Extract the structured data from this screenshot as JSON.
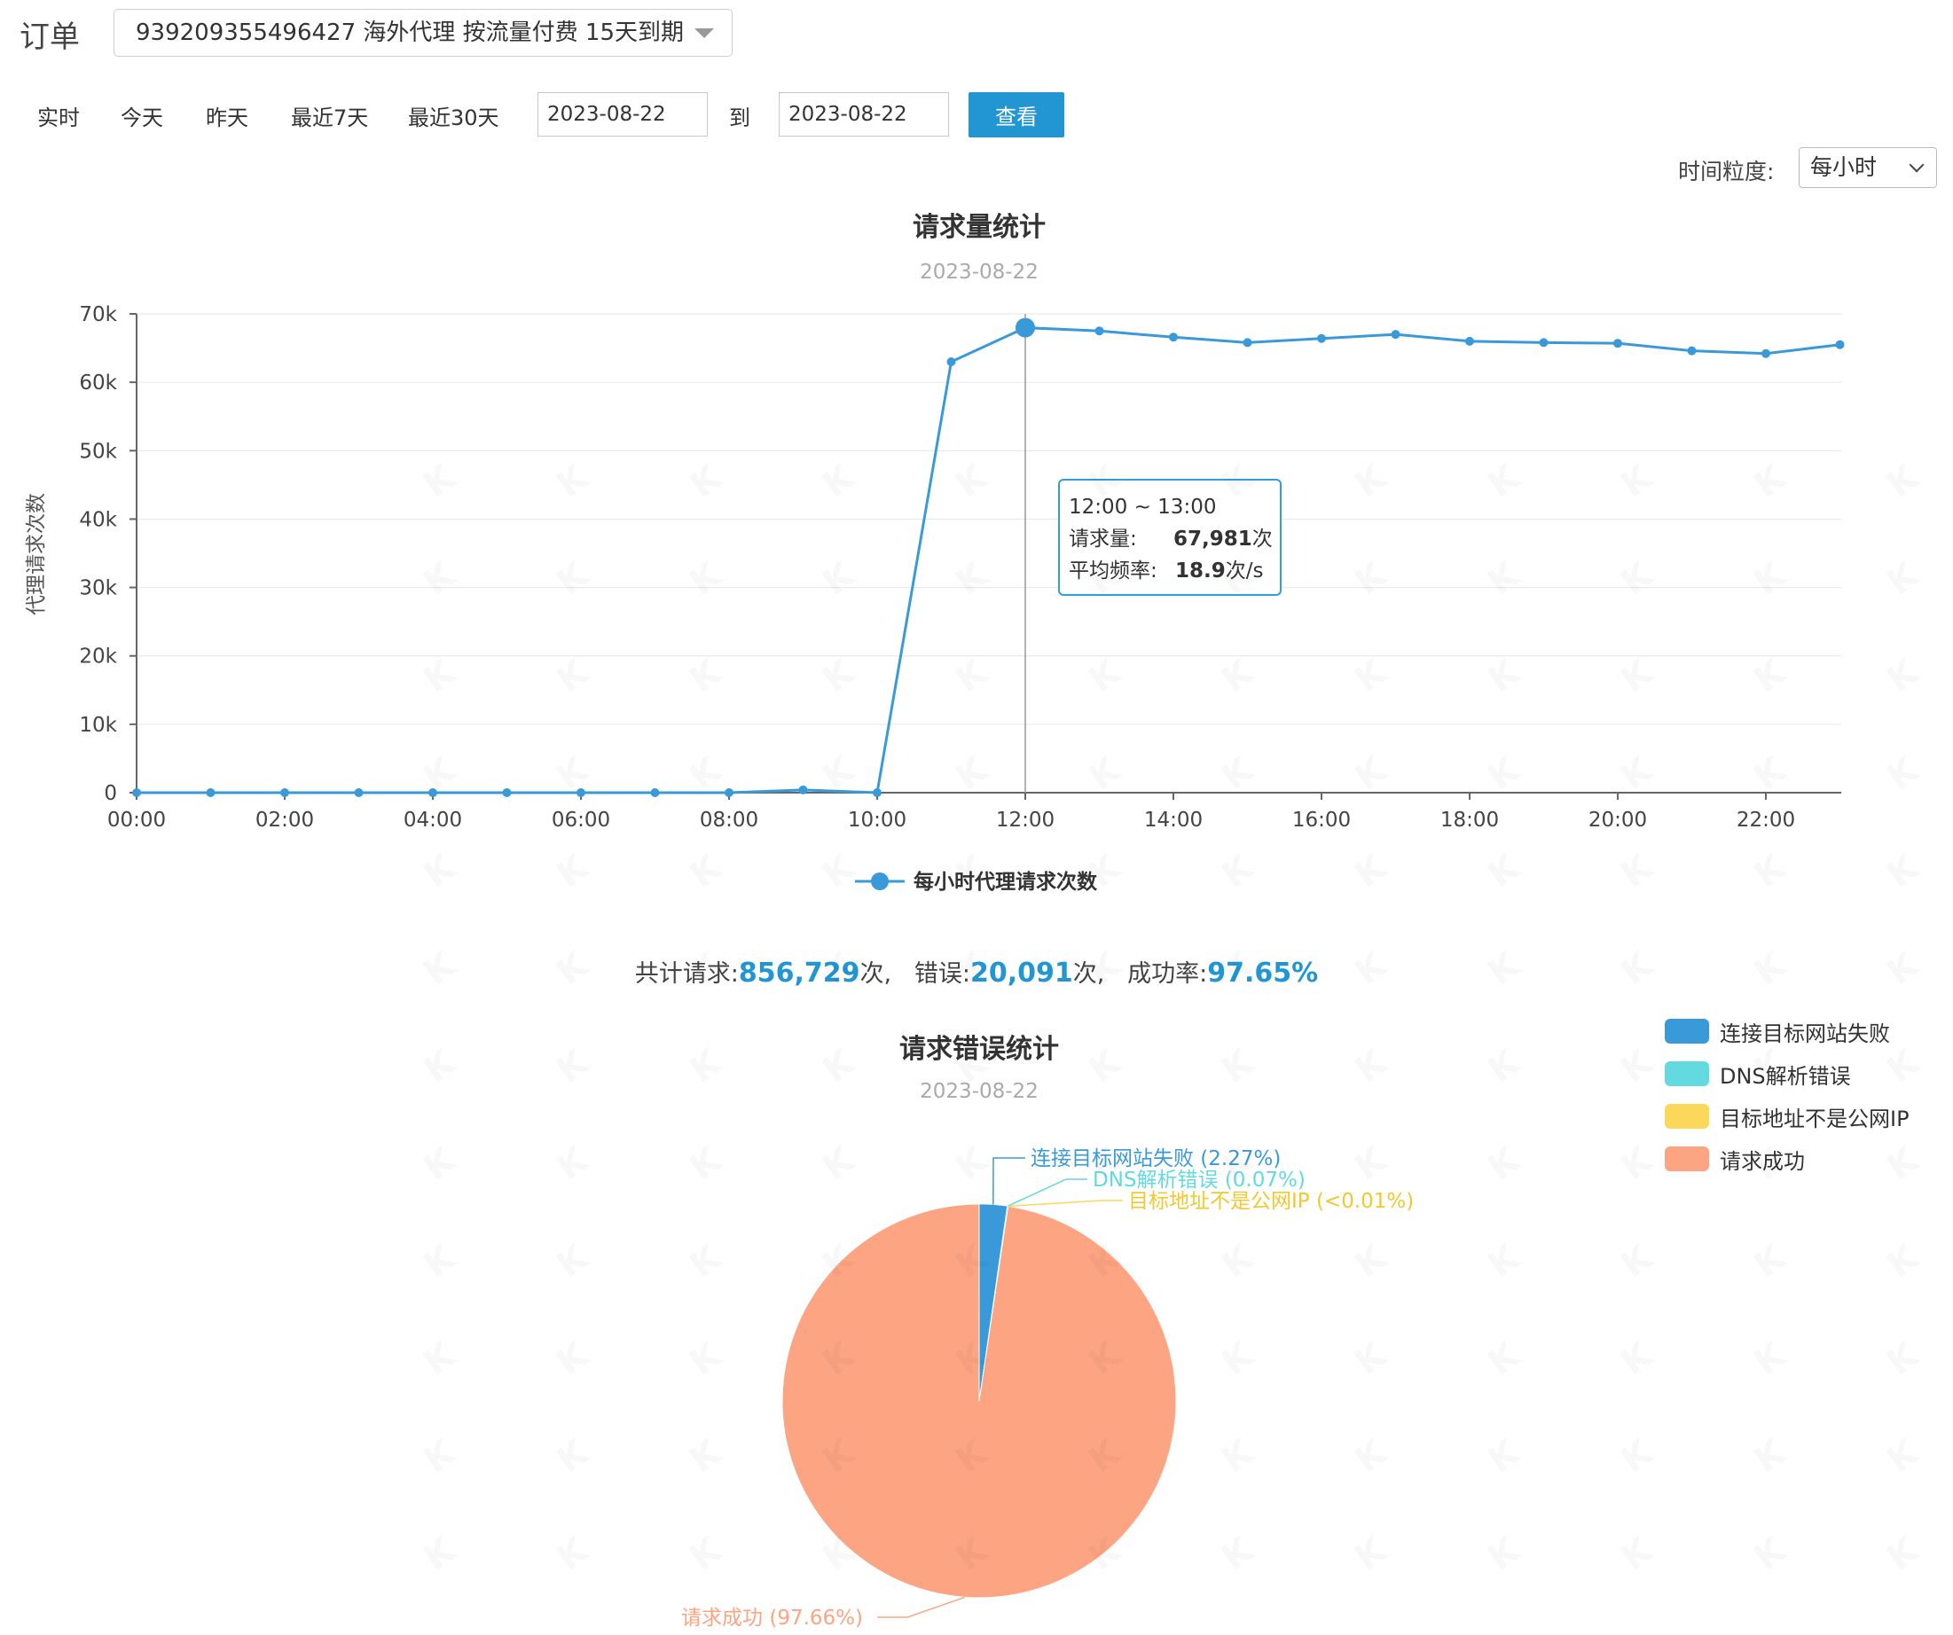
{
  "header": {
    "order_label": "订单",
    "order_select_value": "939209355496427  海外代理  按流量付费  15天到期"
  },
  "range": {
    "links": [
      "实时",
      "今天",
      "昨天",
      "最近7天",
      "最近30天"
    ],
    "start_date": "2023-08-22",
    "to_label": "到",
    "end_date": "2023-08-22",
    "view_button": "查看"
  },
  "granularity": {
    "label": "时间粒度:",
    "value": "每小时"
  },
  "colors": {
    "primary": "#2196d3",
    "line": "#3a9ad9",
    "error_connect": "#3a9ad9",
    "error_dns": "#63d9e0",
    "error_ip": "#fcd85a",
    "success": "#fda482"
  },
  "line_chart": {
    "title": "请求量统计",
    "subtitle": "2023-08-22",
    "y_axis_label": "代理请求次数",
    "legend_label": "每小时代理请求次数",
    "tooltip": {
      "range": "12:00 ~ 13:00",
      "req_key": "请求量:",
      "req_value": "67,981",
      "req_unit": "次",
      "freq_key": "平均频率:",
      "freq_value": "18.9",
      "freq_unit": "次/s"
    }
  },
  "summary": {
    "total_label": "共计请求:",
    "total_value": "856,729",
    "total_unit": "次,",
    "error_label": "错误:",
    "error_value": "20,091",
    "error_unit": "次,",
    "rate_label": "成功率:",
    "rate_value": "97.65%"
  },
  "pie_chart": {
    "title": "请求错误统计",
    "subtitle": "2023-08-22",
    "legend": [
      "连接目标网站失败",
      "DNS解析错误",
      "目标地址不是公网IP",
      "请求成功"
    ]
  },
  "chart_data": [
    {
      "type": "line",
      "title": "请求量统计",
      "subtitle": "2023-08-22",
      "ylabel": "代理请求次数",
      "xlabel": "",
      "x": [
        "00:00",
        "01:00",
        "02:00",
        "03:00",
        "04:00",
        "05:00",
        "06:00",
        "07:00",
        "08:00",
        "09:00",
        "10:00",
        "11:00",
        "12:00",
        "13:00",
        "14:00",
        "15:00",
        "16:00",
        "17:00",
        "18:00",
        "19:00",
        "20:00",
        "21:00",
        "22:00",
        "23:00"
      ],
      "x_tick_labels": [
        "00:00",
        "02:00",
        "04:00",
        "06:00",
        "08:00",
        "10:00",
        "12:00",
        "14:00",
        "16:00",
        "18:00",
        "20:00",
        "22:00"
      ],
      "y_tick_labels": [
        "0",
        "10k",
        "20k",
        "30k",
        "40k",
        "50k",
        "60k",
        "70k"
      ],
      "ylim": [
        0,
        70000
      ],
      "grid": true,
      "legend_position": "bottom",
      "series": [
        {
          "name": "每小时代理请求次数",
          "values": [
            0,
            0,
            0,
            0,
            0,
            0,
            0,
            0,
            0,
            400,
            0,
            63000,
            67981,
            67500,
            66600,
            65800,
            66400,
            67000,
            66000,
            65800,
            65700,
            64600,
            64200,
            65500
          ]
        }
      ],
      "highlight_index": 12
    },
    {
      "type": "pie",
      "title": "请求错误统计",
      "subtitle": "2023-08-22",
      "legend_position": "top-right",
      "slices": [
        {
          "label": "连接目标网站失败",
          "value": 2.27,
          "display": "连接目标网站失败 (2.27%)"
        },
        {
          "label": "DNS解析错误",
          "value": 0.07,
          "display": "DNS解析错误 (0.07%)"
        },
        {
          "label": "目标地址不是公网IP",
          "value": 0.005,
          "display": "目标地址不是公网IP (<0.01%)"
        },
        {
          "label": "请求成功",
          "value": 97.66,
          "display": "请求成功 (97.66%)"
        }
      ]
    }
  ]
}
